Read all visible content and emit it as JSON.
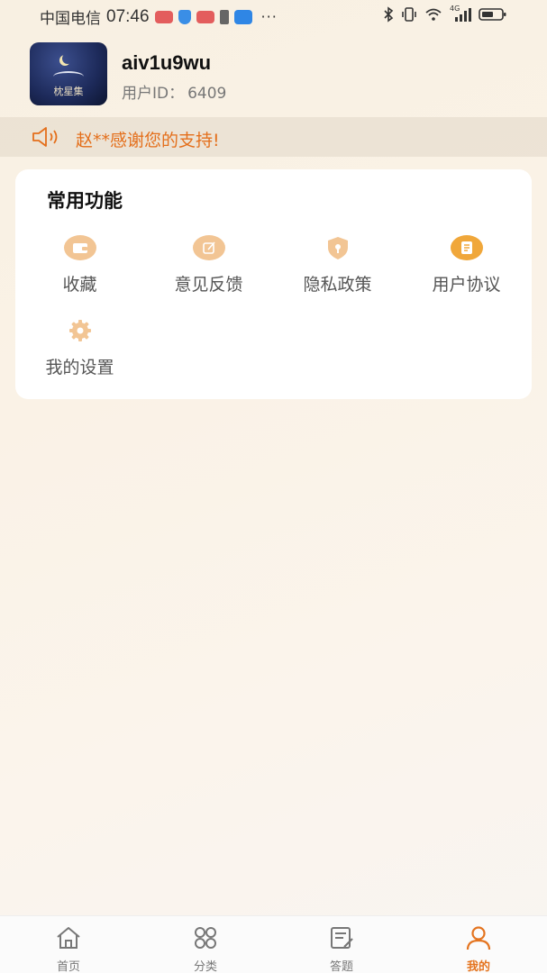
{
  "status_bar": {
    "carrier": "中国电信",
    "time": "07:46",
    "more": "···",
    "network": "4G"
  },
  "profile": {
    "username": "aiv1u9wu",
    "id_label": "用户ID：",
    "id_value": "6409",
    "avatar_text": "枕星集"
  },
  "notice": {
    "text": "赵**感谢您的支持!"
  },
  "functions": {
    "title": "常用功能",
    "items": [
      {
        "label": "收藏",
        "icon": "wallet-icon"
      },
      {
        "label": "意见反馈",
        "icon": "edit-icon"
      },
      {
        "label": "隐私政策",
        "icon": "shield-icon"
      },
      {
        "label": "用户协议",
        "icon": "document-icon"
      },
      {
        "label": "我的设置",
        "icon": "gear-icon"
      }
    ]
  },
  "tabbar": {
    "items": [
      {
        "label": "首页",
        "icon": "home-icon",
        "active": false
      },
      {
        "label": "分类",
        "icon": "category-icon",
        "active": false
      },
      {
        "label": "答题",
        "icon": "quiz-icon",
        "active": false
      },
      {
        "label": "我的",
        "icon": "profile-icon",
        "active": true
      }
    ]
  },
  "colors": {
    "accent": "#e4741f",
    "icon_bg": "#f2c594",
    "notice_text": "#e46f1b"
  }
}
